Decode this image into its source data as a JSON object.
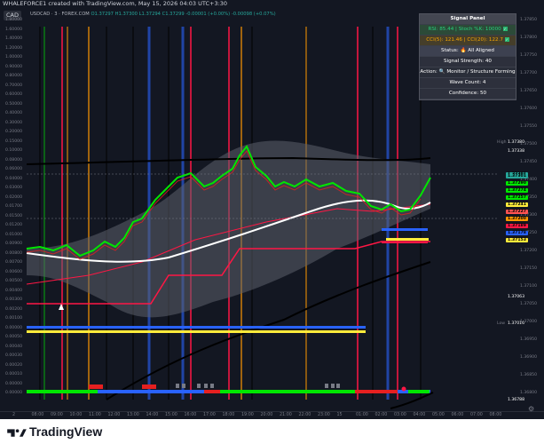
{
  "header": {
    "created_text": "WHALEFORCE1 created with TradingView.com, May 15, 2026 04:03 UTC+3:30",
    "currency_button": "CAD",
    "symbol_info": "USDCAD · 3 · FOREX.COM",
    "ohlc": "O1.37297 H1.37300 L1.37294 C1.37299 -0.00001 (+0.00%) -0.00098 (+0.07%)"
  },
  "panel": {
    "title": "Signal Panel",
    "rsi": "RSI: 85.44 | Stoch %K: 10000",
    "cci": "CCI(5): 121.46 | CCI(20): 122.7",
    "status": "Status: 🔥 All Aligned",
    "strength": "Signal Strength: 40",
    "action": "Action: 🔍 Monitor / Structure Forming",
    "wave": "Wave Count: 4",
    "confidence": "Confidence: 50"
  },
  "left_axis": [
    "1.80000",
    "1.60000",
    "1.40000",
    "1.20000",
    "1.00000",
    "0.90000",
    "0.80000",
    "0.70000",
    "0.60000",
    "0.50000",
    "0.40000",
    "0.30000",
    "0.20000",
    "0.15000",
    "0.10000",
    "0.08000",
    "0.06000",
    "0.04000",
    "0.03000",
    "0.02000",
    "0.01700",
    "0.01500",
    "0.01200",
    "0.01000",
    "0.00900",
    "0.00800",
    "0.00700",
    "0.00600",
    "0.00500",
    "0.00400",
    "0.00300",
    "0.00200",
    "0.00100",
    "0.00000",
    "0.00050",
    "0.00040",
    "0.00030",
    "0.00020",
    "0.00010",
    "0.00000",
    "0.00000"
  ],
  "right_axis": {
    "ticks": [
      "1.37850",
      "1.37800",
      "1.37750",
      "1.37700",
      "1.37650",
      "1.37600",
      "1.37550",
      "1.37500",
      "1.37450",
      "1.37400",
      "1.37350",
      "1.37300",
      "1.37250",
      "1.37200",
      "1.37150",
      "1.37100",
      "1.37050",
      "1.37000",
      "1.36950",
      "1.36900",
      "1.36850",
      "1.36800"
    ],
    "high_label": "High",
    "high_value": "1.37380",
    "high2": "1.37338",
    "last": "1.37301",
    "low_label": "Low",
    "low_value": "1.37016",
    "v1": "1.37063",
    "bottom_value": "1.36788",
    "tag_values": [
      "1.37301",
      "1.37290",
      "1.37274",
      "1.37257",
      "1.37241",
      "1.37227",
      "1.37200",
      "1.37189",
      "1.37178",
      "1.37153"
    ]
  },
  "time_axis": [
    "2",
    "08:00",
    "09:00",
    "10:00",
    "11:00",
    "12:00",
    "13:00",
    "14:00",
    "15:00",
    "16:00",
    "17:00",
    "18:00",
    "19:00",
    "20:00",
    "21:00",
    "22:00",
    "23:00",
    "15",
    "01:00",
    "02:00",
    "03:00",
    "04:00",
    "05:00",
    "06:00",
    "07:00",
    "08:00"
  ],
  "wave_labels": [
    "89",
    "34",
    "21",
    "34",
    "13",
    "21",
    "34",
    "8",
    "13",
    "8",
    "55",
    "34",
    "55",
    "21",
    "34",
    "55",
    "13"
  ],
  "footer": {
    "brand": "TradingView"
  },
  "colors": {
    "bg": "#131722",
    "candle_up": "#00e600",
    "candle_down": "#e62020",
    "ma_white": "#ffffff",
    "band": "#5d606b",
    "red_line": "#ff1744",
    "blue_line": "#2962ff",
    "yellow_line": "#ffeb3b"
  }
}
